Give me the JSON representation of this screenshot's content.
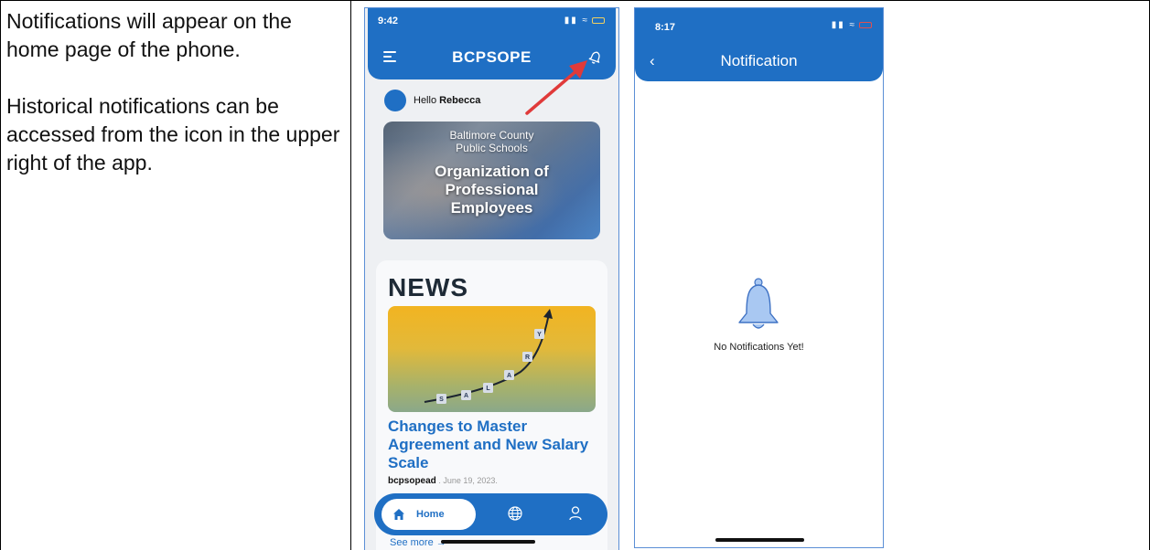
{
  "instructions": {
    "paragraph1": "Notifications will appear on the home page of the phone.",
    "paragraph2": "Historical notifications can be accessed from the icon in the upper right of the app."
  },
  "home_screen": {
    "status_time": "9:42",
    "app_title": "BCPSOPE",
    "greeting_prefix": "Hello",
    "user_name": "Rebecca",
    "banner": {
      "subtitle_line1": "Baltimore County",
      "subtitle_line2": "Public Schools",
      "title_line1": "Organization of",
      "title_line2": "Professional",
      "title_line3": "Employees"
    },
    "news": {
      "heading": "NEWS",
      "image_letters": [
        "S",
        "A",
        "L",
        "A",
        "R",
        "Y"
      ],
      "article_title": "Changes to Master Agreement and New Salary Scale",
      "author": "bcpsopead",
      "date": ". June 19, 2023."
    },
    "nav": {
      "home_label": "Home"
    },
    "see_more": "See more →",
    "icons": [
      "menu-icon",
      "bell-icon",
      "home-icon",
      "globe-icon",
      "user-icon"
    ]
  },
  "notification_screen": {
    "status_time": "8:17",
    "back_glyph": "‹",
    "title": "Notification",
    "empty_message": "No Notifications Yet!",
    "icons": [
      "back-icon",
      "bell-icon"
    ]
  },
  "colors": {
    "brand_blue": "#1f6fc4",
    "arrow_red": "#e03a3a",
    "bell_fill": "#a9c8f2"
  }
}
